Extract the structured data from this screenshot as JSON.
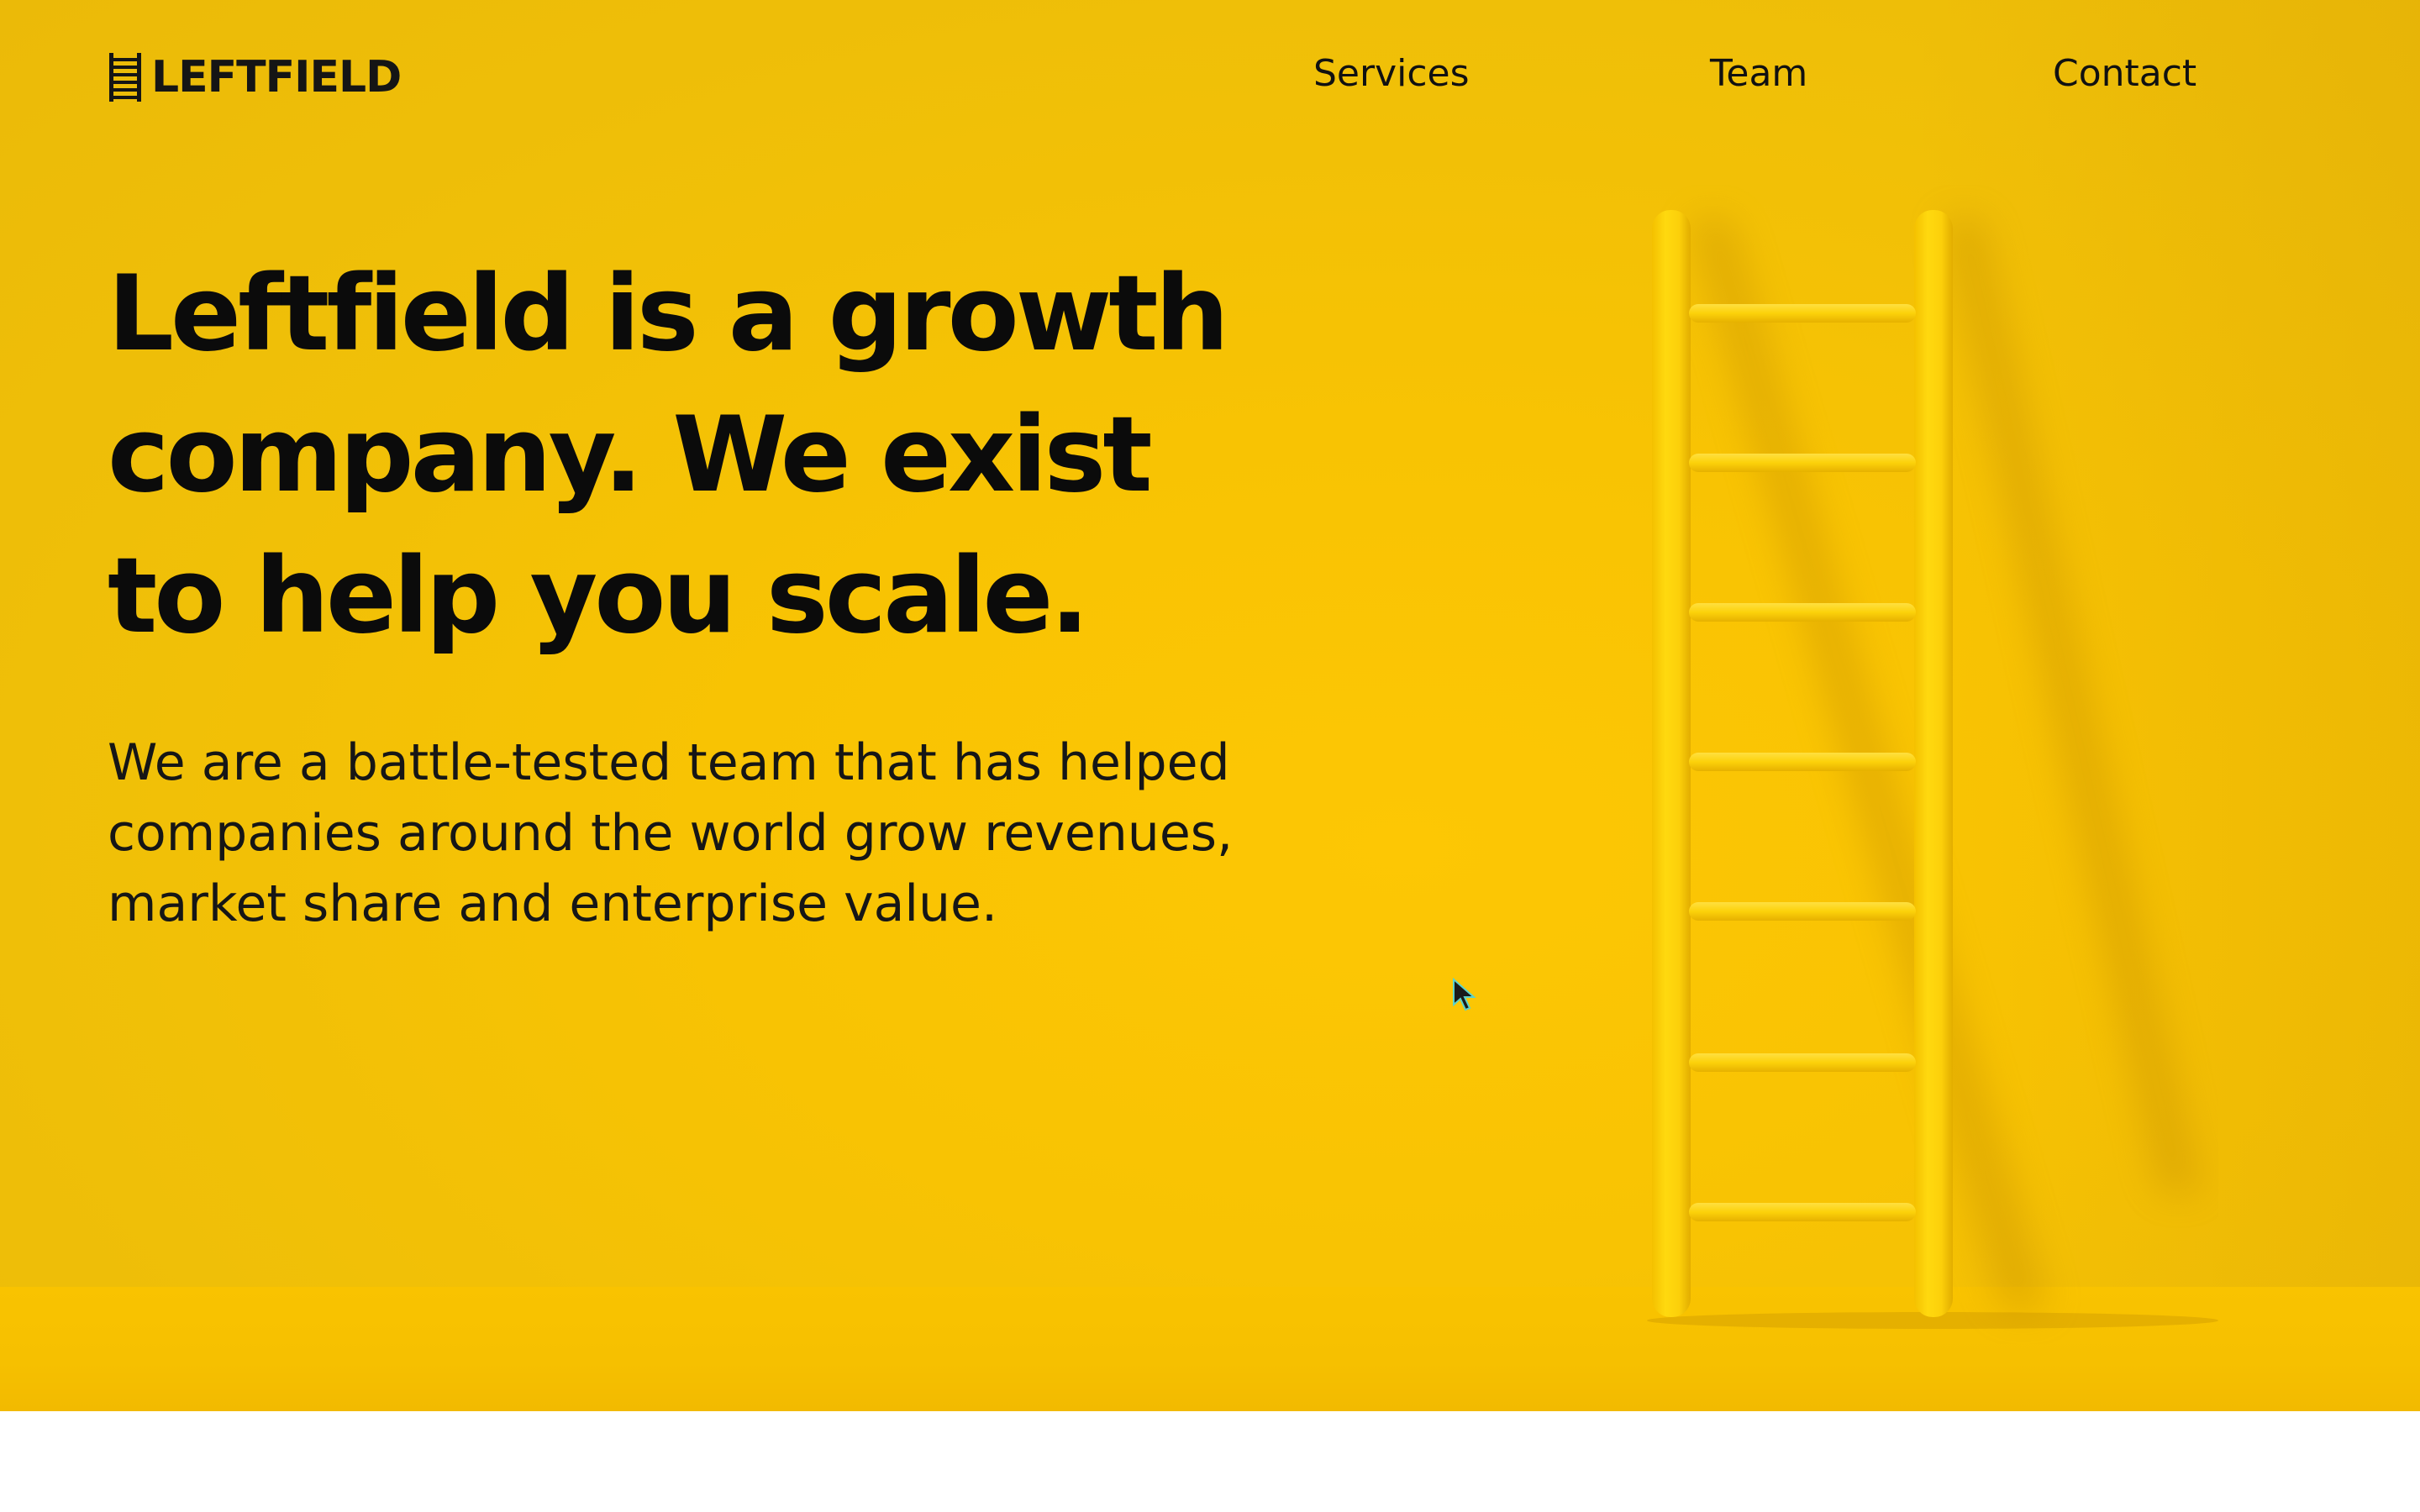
{
  "brand": {
    "name": "LEFTFIELD",
    "logo_icon": "ladder-icon"
  },
  "nav": {
    "items": [
      {
        "label": "Services"
      },
      {
        "label": "Team"
      },
      {
        "label": "Contact"
      }
    ]
  },
  "hero": {
    "headline_lines": [
      "Leftfield is a growth",
      "company. We exist",
      "to help you scale."
    ],
    "lede": "We are a battle-tested team that has helped companies around the world grow revenues, market share and enterprise value.",
    "image": "yellow-ladder-illustration"
  },
  "colors": {
    "hero_background": "#f8c303",
    "text": "#0b0b0b",
    "ladder": "#fccf0a"
  }
}
